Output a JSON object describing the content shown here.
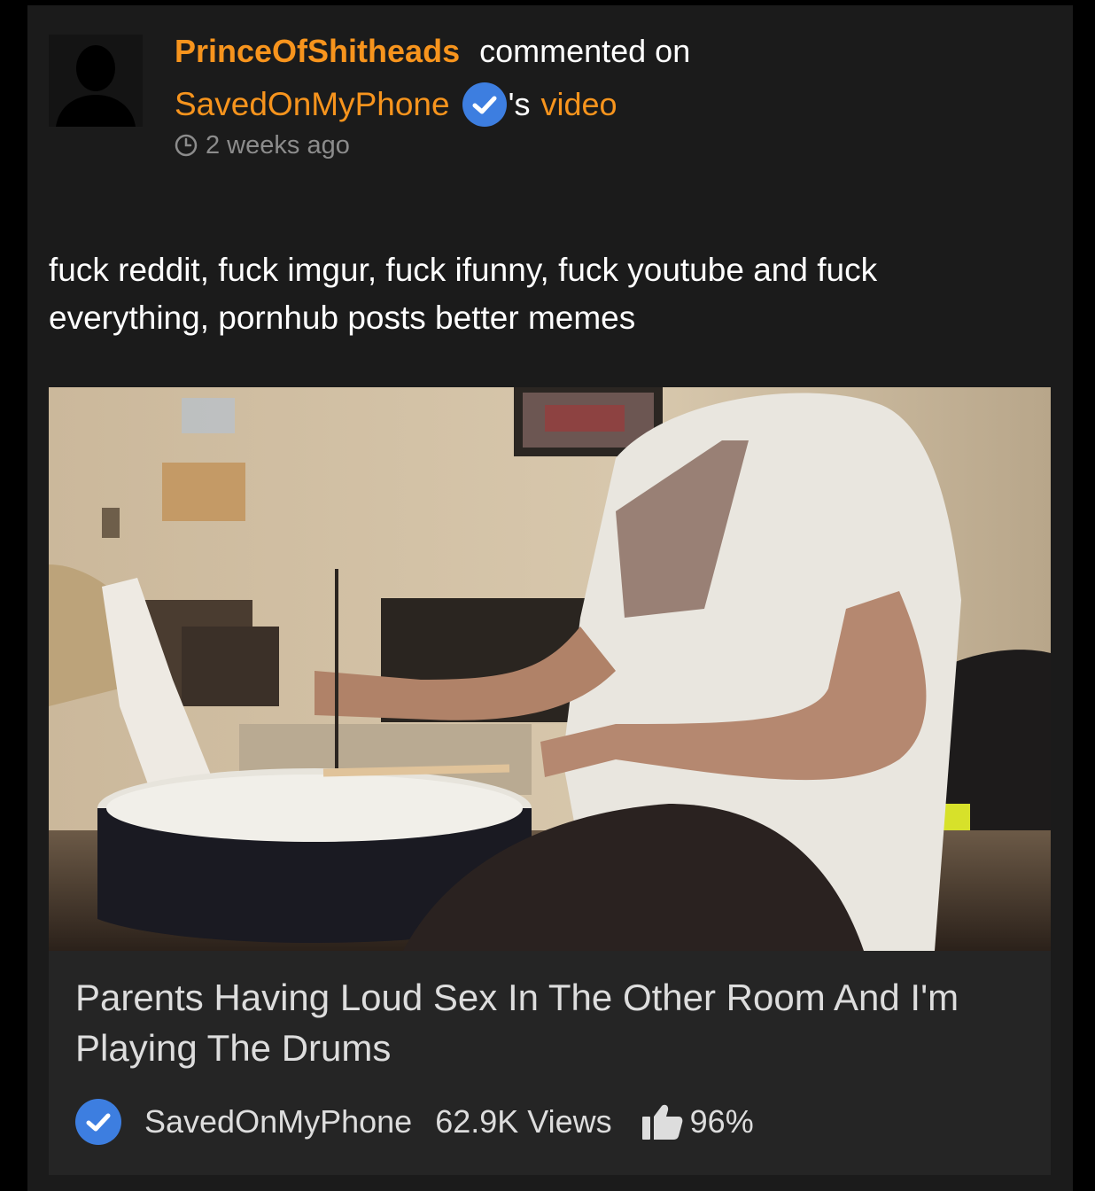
{
  "notification": {
    "username": "PrinceOfShitheads",
    "action": "commented on",
    "channel": "SavedOnMyPhone",
    "possessive": "'s",
    "object": "video",
    "time": "2 weeks ago"
  },
  "comment": {
    "text": "fuck reddit, fuck imgur, fuck ifunny, fuck youtube and fuck everything, pornhub posts better memes"
  },
  "video": {
    "title": "Parents Having Loud Sex In The Other Room And I'm Playing The Drums",
    "channel": "SavedOnMyPhone",
    "views": "62.9K Views",
    "rating": "96%"
  },
  "colors": {
    "accent": "#f7941d",
    "verified": "#3d7ee0",
    "background": "#1b1b1b",
    "info_panel": "#252525"
  },
  "icons": {
    "avatar": "user-silhouette-icon",
    "verified": "verified-check-icon",
    "time": "clock-icon",
    "rating": "thumbs-up-icon"
  }
}
